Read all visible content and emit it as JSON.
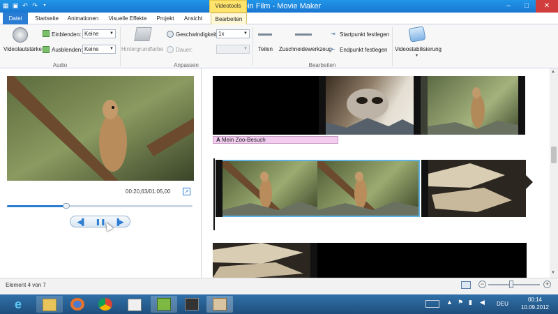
{
  "window": {
    "title": "Mein Film - Movie Maker",
    "context_tab_header": "Videotools",
    "minimize_glyph": "–",
    "maximize_glyph": "□",
    "close_glyph": "✕"
  },
  "tabs": [
    {
      "label": "Datei"
    },
    {
      "label": "Startseite"
    },
    {
      "label": "Animationen"
    },
    {
      "label": "Visuelle Effekte"
    },
    {
      "label": "Projekt"
    },
    {
      "label": "Ansicht"
    },
    {
      "label": "Bearbeiten"
    }
  ],
  "ribbon": {
    "audio": {
      "group_label": "Audio",
      "volume_label": "Videolautstärke",
      "fade_in_label": "Einblenden:",
      "fade_in_value": "Keine",
      "fade_out_label": "Ausblenden:",
      "fade_out_value": "Keine"
    },
    "adjust": {
      "group_label": "Anpassen",
      "background_color_label": "Hintergrundfarbe",
      "speed_label": "Geschwindigkeit:",
      "speed_value": "1x",
      "duration_label": "Dauer:",
      "duration_value": ""
    },
    "edit": {
      "group_label": "Bearbeiten",
      "split_label": "Teilen",
      "trim_label": "Zuschneidewerkzeug",
      "set_start_label": "Startpunkt festlegen",
      "set_end_label": "Endpunkt festlegen",
      "stabilization_label": "Videostabilisierung"
    }
  },
  "preview": {
    "timecode": "00:20,63/01:05,00",
    "position_fraction": 0.32
  },
  "storyboard": {
    "caption_text": "Mein Zoo-Besuch",
    "caption_glyph": "A"
  },
  "status": {
    "text": "Element 4 von 7",
    "zoom_minus": "−",
    "zoom_plus": "+"
  },
  "taskbar": {
    "time": "00:14",
    "date": "10.09.2012",
    "language": "DEU",
    "keyboard_icon": "keyboard-icon"
  },
  "colors": {
    "accent": "#2b7cd3",
    "contextual_tab": "#ffe36a",
    "caption_bg": "#f2cdf0",
    "taskbar": "#2a5c8a"
  }
}
